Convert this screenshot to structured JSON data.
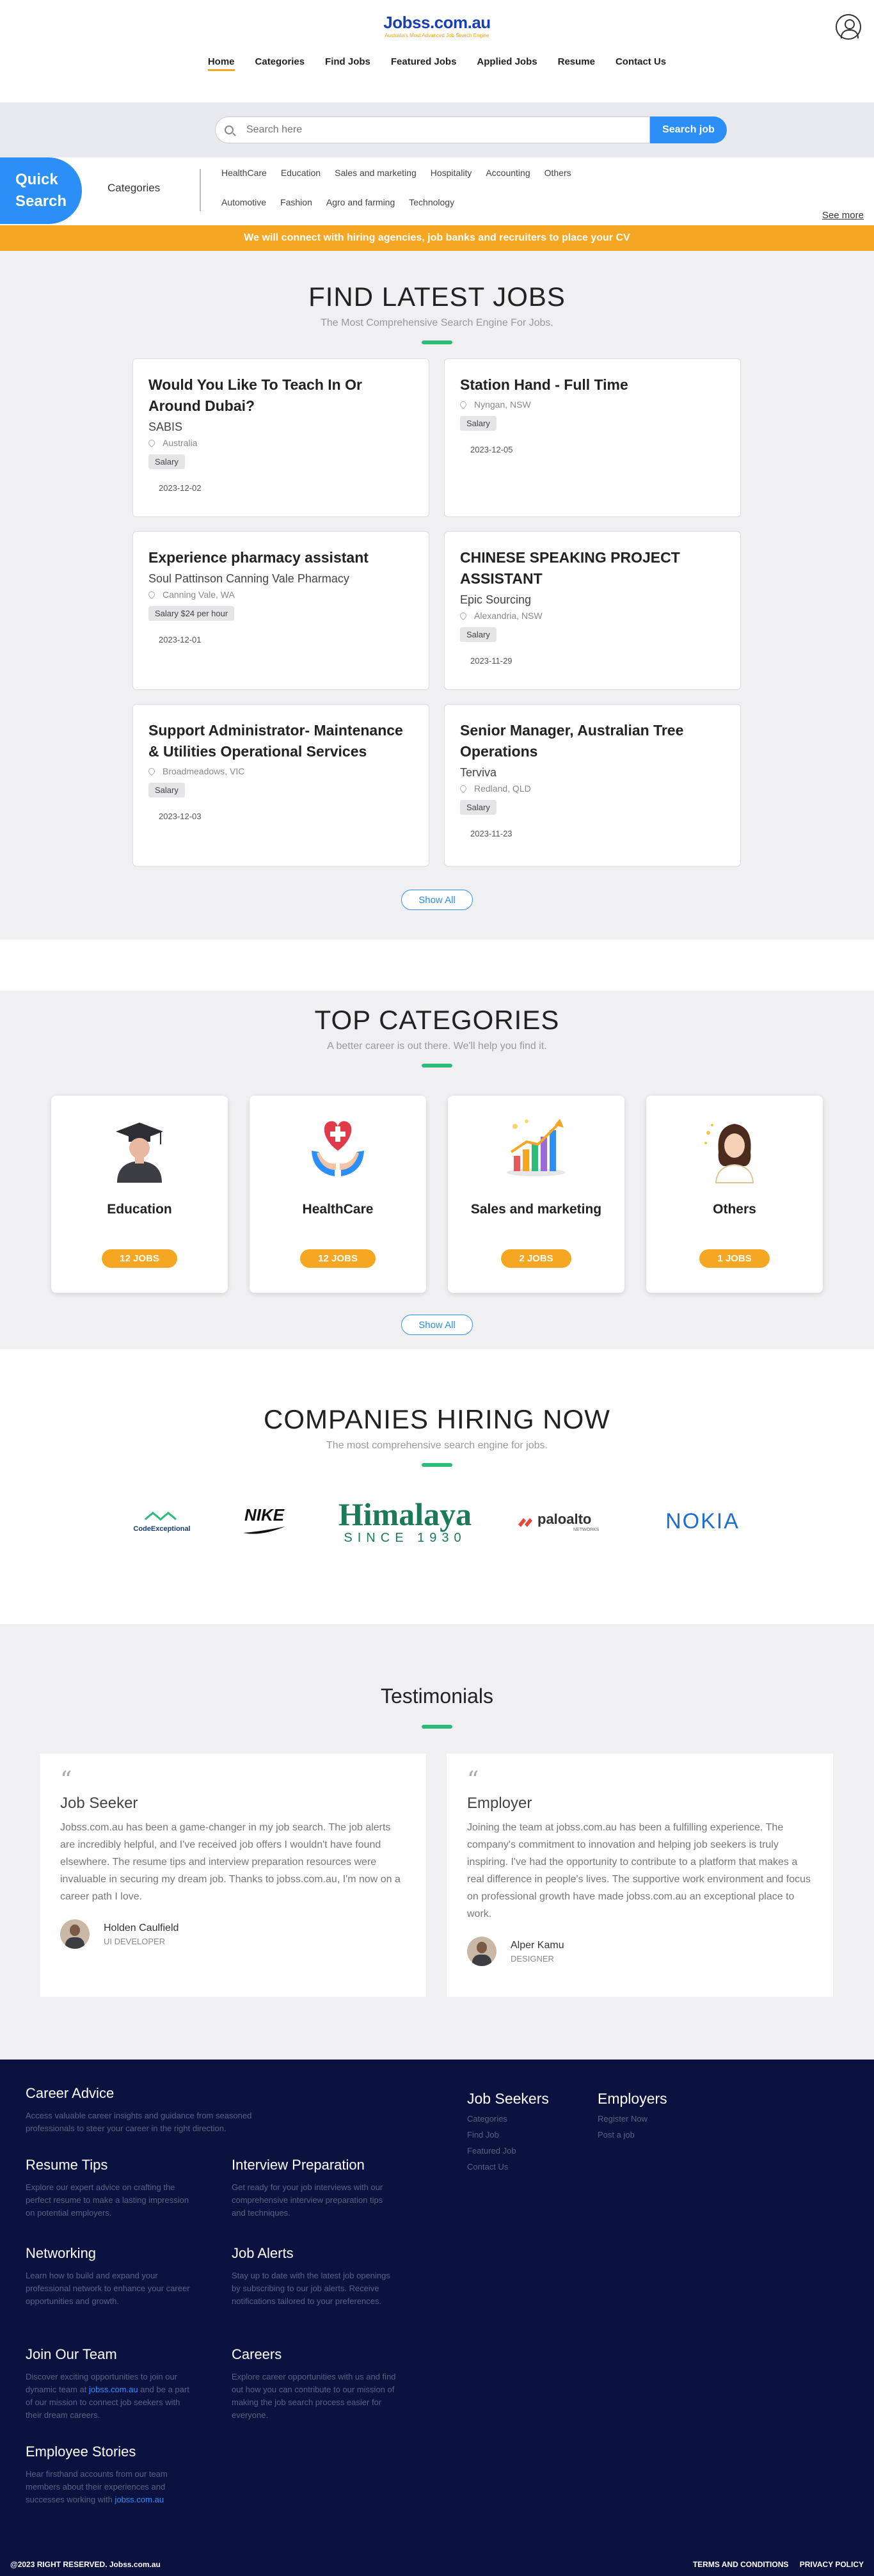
{
  "header": {
    "logo_title": "Jobss.com.au",
    "logo_tag": "Australia's Most Advanced Job Search Engine",
    "nav": [
      "Home",
      "Categories",
      "Find Jobs",
      "Featured Jobs",
      "Applied Jobs",
      "Resume",
      "Contact Us"
    ]
  },
  "search": {
    "placeholder": "Search here",
    "button": "Search job"
  },
  "quick_search": {
    "title_line1": "Quick",
    "title_line2": "Search",
    "label": "Categories",
    "row1": [
      "HealthCare",
      "Education",
      "Sales and marketing",
      "Hospitality",
      "Accounting",
      "Others"
    ],
    "row2": [
      "Automotive",
      "Fashion",
      "Agro and farming",
      "Technology"
    ],
    "see_more": "See more"
  },
  "banner": "We will connect with hiring agencies, job banks and recruiters to place your CV",
  "jobs": {
    "title": "FIND LATEST JOBS",
    "subtitle": "The Most Comprehensive Search Engine For Jobs.",
    "items": [
      {
        "title": "Would You Like To Teach In Or Around Dubai?",
        "company": "SABIS",
        "location": "Australia",
        "salary": "Salary",
        "date": "2023-12-02"
      },
      {
        "title": "Station Hand - Full Time",
        "company": "",
        "location": "Nyngan, NSW",
        "salary": "Salary",
        "date": "2023-12-05"
      },
      {
        "title": "Experience pharmacy assistant",
        "company": "Soul Pattinson Canning Vale Pharmacy",
        "location": "Canning Vale, WA",
        "salary": "Salary $24 per hour",
        "date": "2023-12-01"
      },
      {
        "title": "CHINESE SPEAKING PROJECT ASSISTANT",
        "company": "Epic Sourcing",
        "location": "Alexandria, NSW",
        "salary": "Salary",
        "date": "2023-11-29"
      },
      {
        "title": "Support Administrator- Maintenance & Utilities Operational Services",
        "company": "",
        "location": "Broadmeadows, VIC",
        "salary": "Salary",
        "date": "2023-12-03"
      },
      {
        "title": "Senior Manager, Australian Tree Operations",
        "company": "Terviva",
        "location": "Redland, QLD",
        "salary": "Salary",
        "date": "2023-11-23"
      }
    ],
    "show_all": "Show All"
  },
  "categories": {
    "title": "TOP CATEGORIES",
    "subtitle": "A better career is out there. We'll help you find it.",
    "items": [
      {
        "name": "Education",
        "count": "12 JOBS",
        "icon": "graduate-icon"
      },
      {
        "name": "HealthCare",
        "count": "12 JOBS",
        "icon": "health-hands-icon"
      },
      {
        "name": "Sales and marketing",
        "count": "2 JOBS",
        "icon": "growth-chart-icon"
      },
      {
        "name": "Others",
        "count": "1 JOBS",
        "icon": "person-others-icon"
      }
    ],
    "show_all": "Show All"
  },
  "companies": {
    "title": "COMPANIES HIRING NOW",
    "subtitle": "The most comprehensive search engine for jobs.",
    "logos": {
      "codeexceptional": "CodeExceptional",
      "nike": "NIKE",
      "himalaya": "Himalaya",
      "himalaya_since": "SINCE 1930",
      "paloalto": "paloalto",
      "paloalto_sub": "NETWORKS",
      "nokia": "NOKIA"
    }
  },
  "testimonials": {
    "title": "Testimonials",
    "items": [
      {
        "role": "Job Seeker",
        "text": "Jobss.com.au has been a game-changer in my job search. The job alerts are incredibly helpful, and I've received job offers I wouldn't have found elsewhere. The resume tips and interview preparation resources were invaluable in securing my dream job. Thanks to jobss.com.au, I'm now on a career path I love.",
        "name": "Holden Caulfield",
        "title": "UI DEVELOPER"
      },
      {
        "role": "Employer",
        "text": "Joining the team at jobss.com.au has been a fulfilling experience. The company's commitment to innovation and helping job seekers is truly inspiring. I've had the opportunity to contribute to a platform that makes a real difference in people's lives. The supportive work environment and focus on professional growth have made jobss.com.au an exceptional place to work.",
        "name": "Alper Kamu",
        "title": "DESIGNER"
      }
    ]
  },
  "footer": {
    "blocks": [
      {
        "title": "Career Advice",
        "text": "Access valuable career insights and guidance from seasoned professionals to steer your career in the right direction."
      },
      {
        "title": "Resume Tips",
        "text": "Explore our expert advice on crafting the perfect resume to make a lasting impression on potential employers."
      },
      {
        "title": "Interview Preparation",
        "text": "Get ready for your job interviews with our comprehensive interview preparation tips and techniques."
      },
      {
        "title": "Networking",
        "text": "Learn how to build and expand your professional network to enhance your career opportunities and growth."
      },
      {
        "title": "Job Alerts",
        "text": "Stay up to date with the latest job openings by subscribing to our job alerts. Receive notifications tailored to your preferences."
      },
      {
        "title": "Join Our Team",
        "text_pre": "Discover exciting opportunities to join our dynamic team at",
        "link": "jobss.com.au",
        "text_post": "and be a part of our mission to connect job seekers with their dream careers."
      },
      {
        "title": "Careers",
        "text": "Explore career opportunities with us and find out how you can contribute to our mission of making the job search process easier for everyone."
      },
      {
        "title": "Employee Stories",
        "text_pre": "Hear firsthand accounts from our team members about their experiences and successes working with",
        "link": "jobss.com.au",
        "text_post": ""
      }
    ],
    "job_seekers": {
      "title": "Job Seekers",
      "links": [
        "Categories",
        "Find Job",
        "Featured Job",
        "Contact Us"
      ]
    },
    "employers": {
      "title": "Employers",
      "links": [
        "Register Now",
        "Post a job"
      ]
    },
    "copyright": "@2023 RIGHT RESERVED. Jobss.com.au",
    "terms": "TERMS AND CONDITIONS",
    "privacy": "PRIVACY POLICY"
  }
}
